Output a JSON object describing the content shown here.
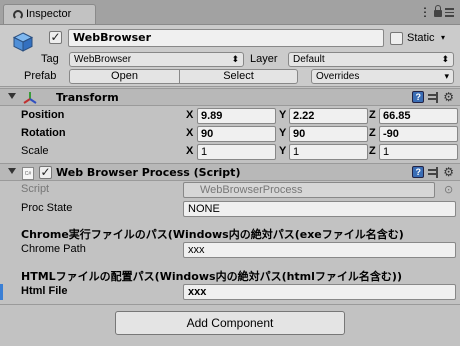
{
  "tab": {
    "title": "Inspector"
  },
  "gameobject": {
    "name": "WebBrowser",
    "static_label": "Static",
    "tag_label": "Tag",
    "tag_value": "WebBrowser",
    "layer_label": "Layer",
    "layer_value": "Default",
    "prefab_label": "Prefab",
    "open_label": "Open",
    "select_label": "Select",
    "overrides_label": "Overrides"
  },
  "transform": {
    "title": "Transform",
    "position_label": "Position",
    "rotation_label": "Rotation",
    "scale_label": "Scale",
    "axis_x": "X",
    "axis_y": "Y",
    "axis_z": "Z",
    "position": {
      "x": "9.89",
      "y": "2.22",
      "z": "66.85"
    },
    "rotation": {
      "x": "90",
      "y": "90",
      "z": "-90"
    },
    "scale": {
      "x": "1",
      "y": "1",
      "z": "1"
    }
  },
  "script_component": {
    "title": "Web Browser Process (Script)",
    "script_icon_text": "C#",
    "script_label": "Script",
    "script_value": "WebBrowserProcess",
    "proc_state_label": "Proc State",
    "proc_state_value": "NONE",
    "chrome_section_header": "Chrome実行ファイルのパス(Windows内の絶対パス(exeファイル名含む)",
    "chrome_path_label": "Chrome Path",
    "chrome_path_value": "xxx",
    "html_section_header": "HTMLファイルの配置パス(Windows内の絶対パス(htmlファイル名含む))",
    "html_file_label": "Html File",
    "html_file_value": "xxx"
  },
  "add_component_label": "Add Component",
  "colors": {
    "panel_bg": "#c2c2c2",
    "focus_accent": "#3a7fd5",
    "help_icon": "#3a6db5"
  }
}
